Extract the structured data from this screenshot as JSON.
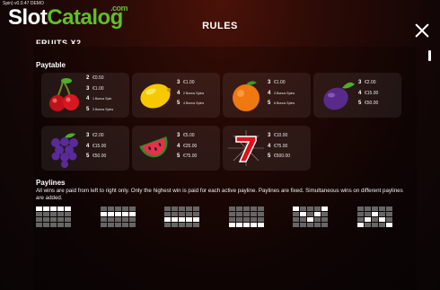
{
  "header": {
    "version": "Spin) v0.0.47 DEMO",
    "logo_slot": "Slot",
    "logo_catalog": "Catalog",
    "logo_com": ".com",
    "title": "RULES",
    "cut_heading": "FRUITS X2"
  },
  "paytable": {
    "title": "Paytable",
    "symbols": [
      {
        "name": "cherries",
        "pays": [
          [
            "2",
            "€0.50"
          ],
          [
            "3",
            "€1.00"
          ],
          [
            "4",
            "1 Bonus Spin"
          ],
          [
            "5",
            "3 Bonus Spins"
          ]
        ]
      },
      {
        "name": "lemon",
        "pays": [
          [
            "3",
            "€1.00"
          ],
          [
            "4",
            "2 Bonus Spins"
          ],
          [
            "5",
            "4 Bonus Spins"
          ]
        ]
      },
      {
        "name": "orange",
        "pays": [
          [
            "3",
            "€1.00"
          ],
          [
            "4",
            "3 Bonus Spins"
          ],
          [
            "5",
            "6 Bonus Spins"
          ]
        ]
      },
      {
        "name": "plum",
        "pays": [
          [
            "3",
            "€2.00"
          ],
          [
            "4",
            "€15.00"
          ],
          [
            "5",
            "€50.00"
          ]
        ]
      },
      {
        "name": "grapes",
        "pays": [
          [
            "3",
            "€2.00"
          ],
          [
            "4",
            "€15.00"
          ],
          [
            "5",
            "€50.00"
          ]
        ]
      },
      {
        "name": "watermelon",
        "pays": [
          [
            "3",
            "€5.00"
          ],
          [
            "4",
            "€25.00"
          ],
          [
            "5",
            "€75.00"
          ]
        ]
      },
      {
        "name": "seven",
        "pays": [
          [
            "3",
            "€10.00"
          ],
          [
            "4",
            "€75.00"
          ],
          [
            "5",
            "€500.00"
          ]
        ]
      }
    ]
  },
  "paylines": {
    "title": "Paylines",
    "text": "All wins are paid from left to right only. Only the highest win is paid for each active payline. Paylines are fixed. Simultaneous wins on different paylines are added.",
    "patterns": [
      [
        0,
        0,
        0,
        0,
        0
      ],
      [
        1,
        1,
        1,
        1,
        1
      ],
      [
        2,
        2,
        2,
        2,
        2
      ],
      [
        3,
        3,
        3,
        3,
        3
      ],
      [
        0,
        1,
        2,
        1,
        0
      ],
      [
        3,
        2,
        1,
        2,
        3
      ]
    ]
  },
  "colors": {
    "accent_green": "#5fbf2a",
    "inactive_cell": "#666666",
    "active_cell": "#ffffff"
  }
}
